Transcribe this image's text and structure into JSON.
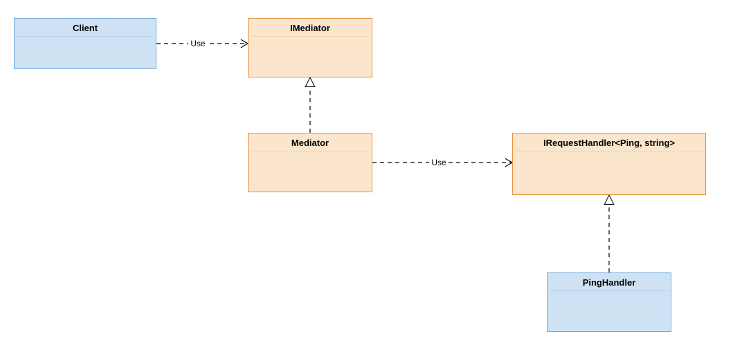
{
  "nodes": {
    "client": {
      "label": "Client"
    },
    "imediator": {
      "label": "IMediator"
    },
    "mediator": {
      "label": "Mediator"
    },
    "ireq": {
      "label": "IRequestHandler<Ping, string>"
    },
    "ping": {
      "label": "PingHandler"
    }
  },
  "edges": {
    "client_imediator": {
      "label": "Use"
    },
    "mediator_ireq": {
      "label": "Use"
    }
  }
}
